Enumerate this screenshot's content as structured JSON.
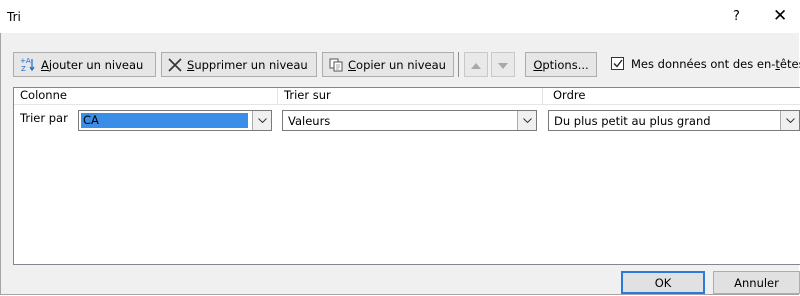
{
  "window": {
    "title": "Tri",
    "help_label": "?",
    "close_label": "✕"
  },
  "toolbar": {
    "add_level": {
      "prefix": "",
      "mnemonic": "A",
      "suffix": "jouter un niveau"
    },
    "delete_level": {
      "prefix": "",
      "mnemonic": "S",
      "suffix": "upprimer un niveau"
    },
    "copy_level": {
      "prefix": "",
      "mnemonic": "C",
      "suffix": "opier un niveau"
    },
    "options": {
      "prefix": "",
      "mnemonic": "O",
      "suffix": "ptions..."
    },
    "header_checkbox": {
      "prefix": "Mes données ont des en-",
      "mnemonic": "t",
      "suffix": "êtes",
      "checked": true
    }
  },
  "grid": {
    "headers": [
      "Colonne",
      "Trier sur",
      "Ordre"
    ],
    "rows": [
      {
        "label": "Trier par",
        "column": "CA",
        "sort_on": "Valeurs",
        "order": "Du plus petit au plus grand"
      }
    ]
  },
  "footer": {
    "ok_label": "OK",
    "cancel_label": "Annuler"
  },
  "colors": {
    "selection": "#3a8ee8",
    "default_button_border": "#2b79d8",
    "dialog_bg": "#f0f0f0"
  }
}
